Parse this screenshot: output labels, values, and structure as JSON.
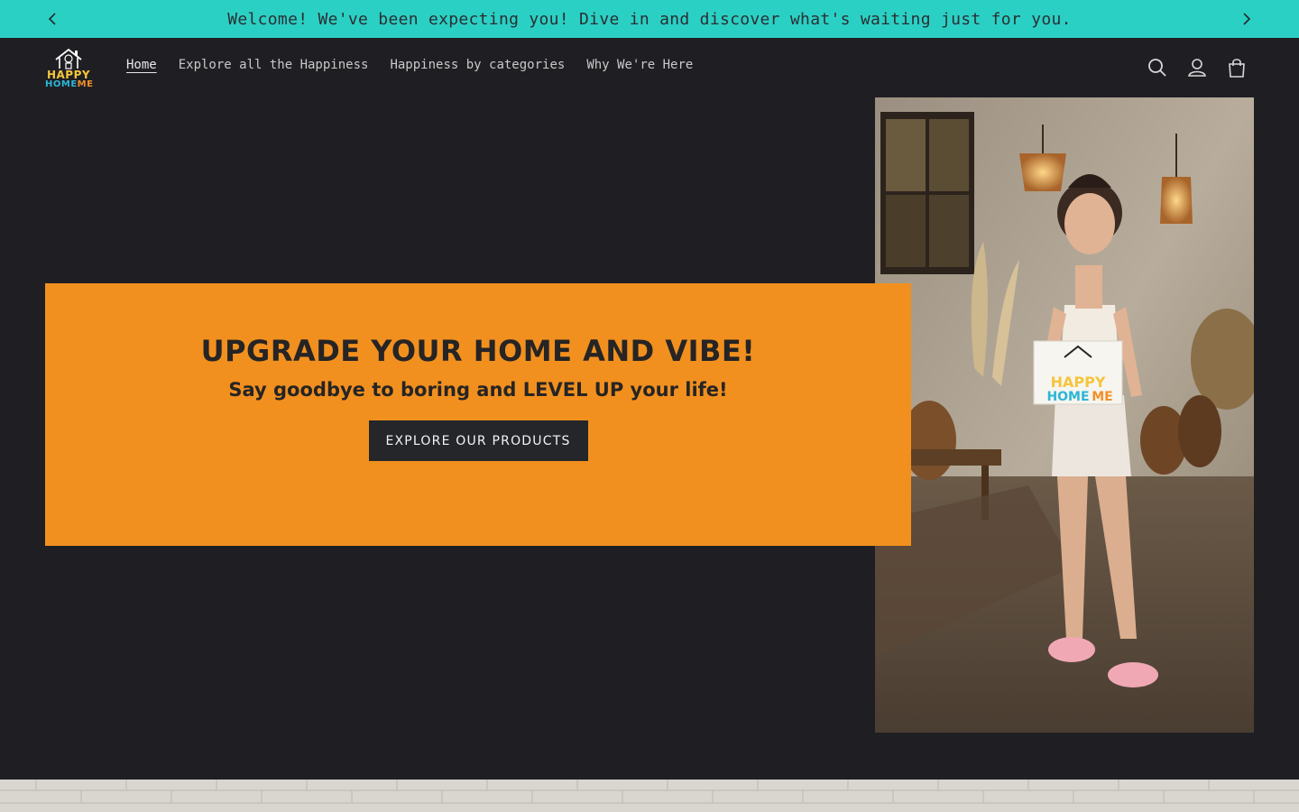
{
  "announcement": {
    "text": "Welcome! We've been expecting you! Dive in and discover what's waiting just for you.",
    "prev_icon": "chevron-left-icon",
    "next_icon": "chevron-right-icon"
  },
  "header": {
    "logo": {
      "line1": "HAPPY",
      "line2_a": "HOME",
      "line2_b": "ME"
    },
    "nav": [
      {
        "label": "Home",
        "active": true
      },
      {
        "label": "Explore all the Happiness",
        "active": false
      },
      {
        "label": "Happiness by categories",
        "active": false
      },
      {
        "label": "Why We're Here",
        "active": false
      }
    ],
    "icons": [
      "search-icon",
      "account-icon",
      "cart-icon"
    ]
  },
  "hero": {
    "title": "UPGRADE YOUR HOME AND VIBE!",
    "subtitle": "Say goodbye to boring and LEVEL UP your life!",
    "button_label": "EXPLORE OUR PRODUCTS",
    "image_sign": {
      "line1": "HAPPY",
      "line2_a": "HOME",
      "line2_b": "ME"
    }
  },
  "colors": {
    "announcement_bg": "#2bd0c4",
    "page_bg": "#1f1f23",
    "hero_card_bg": "#f1901f",
    "button_bg": "#25262a"
  }
}
